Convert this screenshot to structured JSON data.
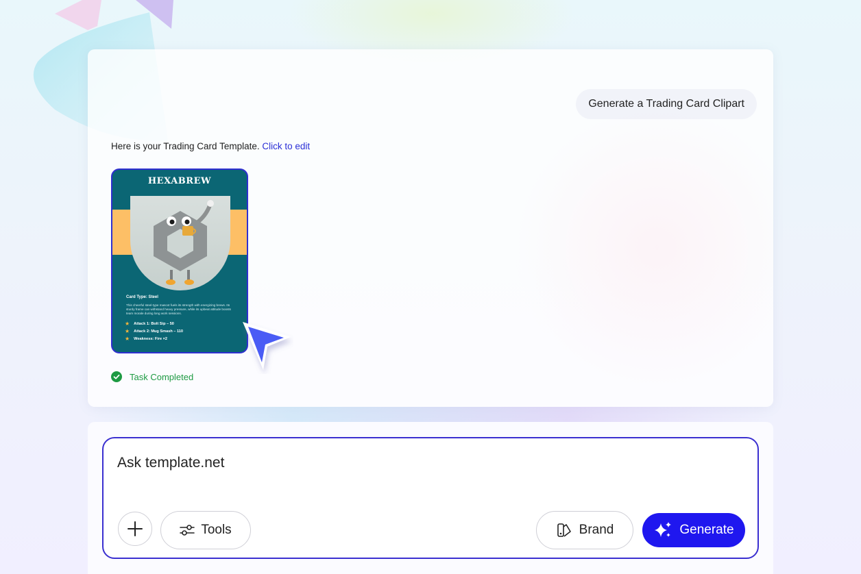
{
  "conversation": {
    "user_prompt": "Generate a Trading Card Clipart",
    "reply_text": "Here is your Trading Card Template.",
    "reply_link": "Click to edit",
    "status": "Task Completed"
  },
  "trading_card": {
    "title": "HEXABREW",
    "card_type": "Card Type: Steel",
    "description": "This cheerful steel-type mascot fuels its strength with energizing brews. Its sturdy frame can withstand heavy pressure, while its upbeat attitude boosts team morale during long work sessions.",
    "stats": [
      {
        "label": "Attack 1: Bolt Sip – 50"
      },
      {
        "label": "Attack 2: Mug Smash – 110"
      },
      {
        "label": "Weakness: Fire ×2"
      }
    ],
    "colors": {
      "background": "#0b6674",
      "band": "#fdbf66",
      "border": "#2f2fd0",
      "star": "#f5b73c"
    }
  },
  "composer": {
    "placeholder": "Ask template.net",
    "tools_label": "Tools",
    "brand_label": "Brand",
    "generate_label": "Generate"
  },
  "icons": [
    "plus-icon",
    "sliders-icon",
    "brand-palette-icon",
    "sparkles-icon",
    "check-circle-icon",
    "star-icon",
    "cursor-pointer-icon"
  ],
  "colors": {
    "accent": "#1f17ef",
    "link": "#2b2fd6",
    "success": "#1e9a43",
    "composer_border": "#3a2fd0"
  }
}
